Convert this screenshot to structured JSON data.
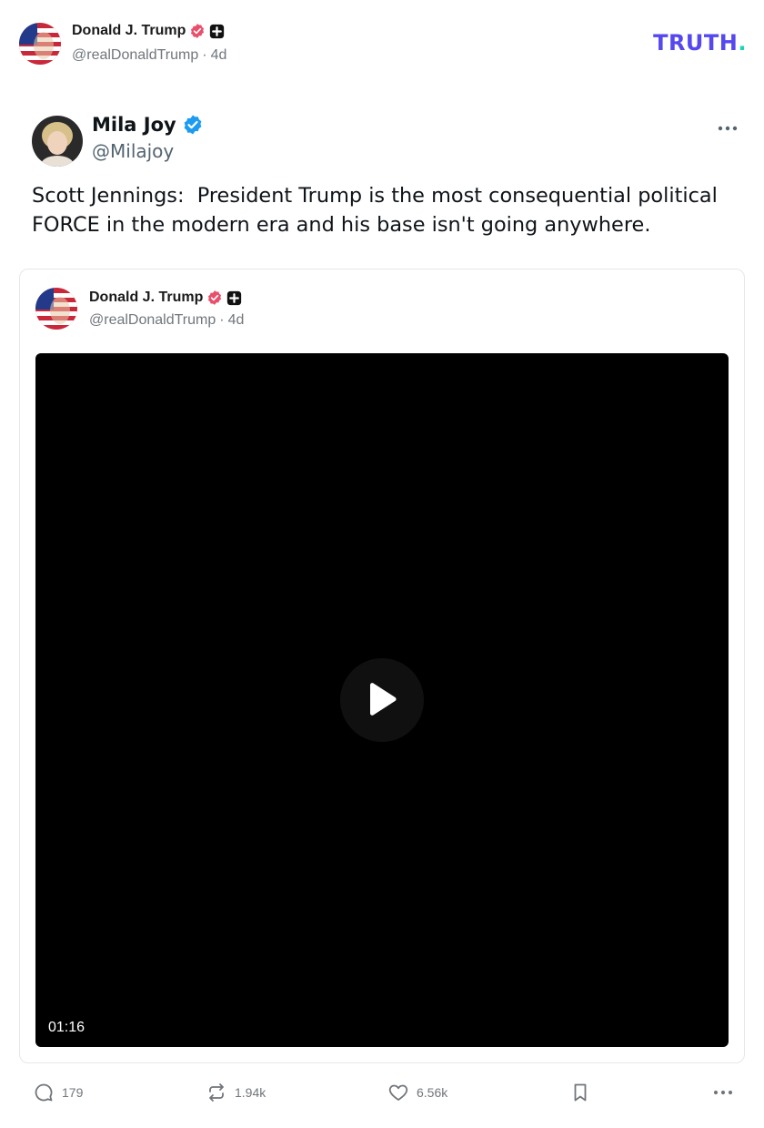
{
  "post": {
    "author_name": "Donald J. Trump",
    "author_handle": "@realDonaldTrump",
    "separator": "·",
    "age": "4d"
  },
  "brand": {
    "logo_text": "TRUTH",
    "logo_dot": ".",
    "colors": {
      "primary": "#5448ee",
      "accent": "#1dd6b8"
    }
  },
  "tweet": {
    "name": "Mila Joy",
    "handle": "@Milajoy",
    "text": "Scott Jennings:  President Trump is the most consequential political\nFORCE in the modern era and his base isn't going anywhere.",
    "more_icon": "more-horizontal-icon"
  },
  "quote": {
    "author_name": "Donald J. Trump",
    "author_handle": "@realDonaldTrump",
    "separator": "·",
    "age": "4d",
    "video": {
      "duration": "01:16",
      "icon": "play-icon"
    }
  },
  "actions": {
    "replies": "179",
    "retruths": "1.94k",
    "likes": "6.56k"
  },
  "colors": {
    "verified_badge": "#e94e6b",
    "tweet_verified": "#1d9bf0",
    "muted_text": "#71767b"
  }
}
